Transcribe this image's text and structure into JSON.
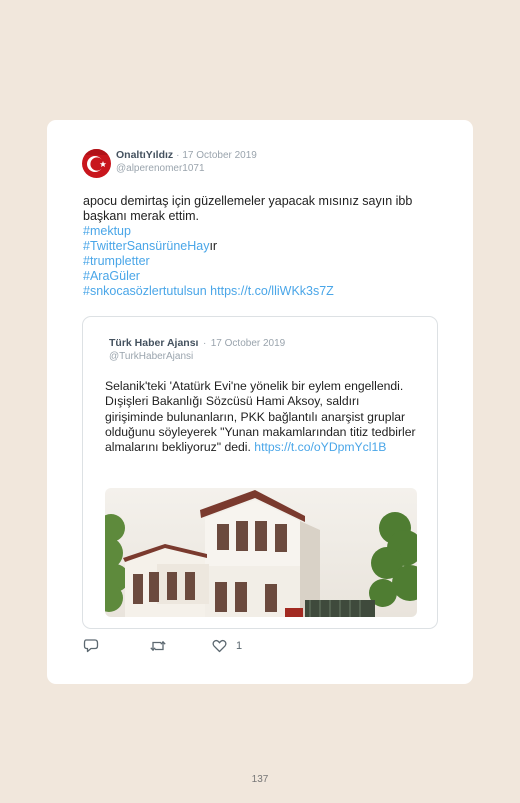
{
  "tweet": {
    "author_name": "OnaltıYıldız",
    "separator": "·",
    "date": "17 October 2019",
    "handle": "@alperenomer1071",
    "text": "apocu demirtaş için güzellemeler yapacak mısınız sayın ibb başkanı merak ettim.",
    "hashtags": {
      "h1": "#mektup",
      "h2": "#TwitterSansürüneHay",
      "h2_suffix": "ır",
      "h3": "#trumpletter",
      "h4": "#AraGüler",
      "h5": "#snkocasözlertutulsun"
    },
    "url": "https://t.co/lliWKk3s7Z",
    "like_count": "1"
  },
  "quoted": {
    "author_name": "Türk Haber Ajansı",
    "separator": "·",
    "date": "17 October 2019",
    "handle": "@TurkHaberAjansi",
    "text": "Selanik'teki 'Atatürk Evi'ne yönelik bir eylem engellendi. Dışişleri Bakanlığı Sözcüsü Hami Aksoy, saldırı girişiminde bulunanların, PKK bağlantılı anarşist gruplar olduğunu söyleyerek \"Yunan makamlarından titiz tedbirler almalarını bekliyoruz\" dedi.",
    "url": "https://t.co/oYDpmYcl1B"
  },
  "page_number": "137",
  "colors": {
    "background": "#f1e7dc",
    "link": "#4aa6e8",
    "avatar": "#c8161d"
  },
  "icons": [
    "reply-icon",
    "retweet-icon",
    "heart-icon",
    "avatar-crescent-star"
  ]
}
